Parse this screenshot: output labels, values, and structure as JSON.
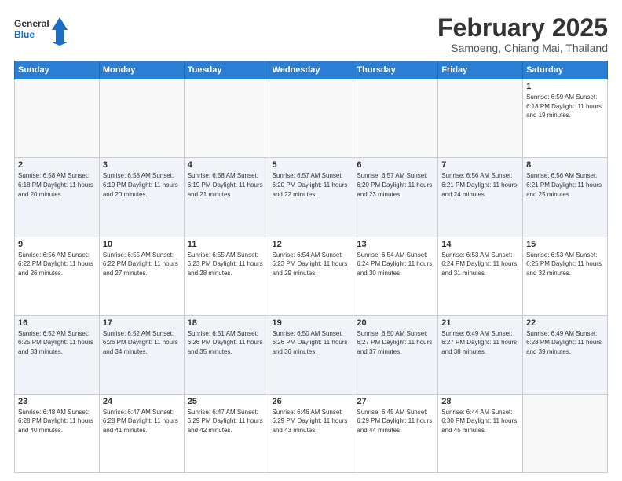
{
  "logo": {
    "text_general": "General",
    "text_blue": "Blue"
  },
  "header": {
    "title": "February 2025",
    "subtitle": "Samoeng, Chiang Mai, Thailand"
  },
  "weekdays": [
    "Sunday",
    "Monday",
    "Tuesday",
    "Wednesday",
    "Thursday",
    "Friday",
    "Saturday"
  ],
  "weeks": [
    [
      {
        "day": "",
        "info": ""
      },
      {
        "day": "",
        "info": ""
      },
      {
        "day": "",
        "info": ""
      },
      {
        "day": "",
        "info": ""
      },
      {
        "day": "",
        "info": ""
      },
      {
        "day": "",
        "info": ""
      },
      {
        "day": "1",
        "info": "Sunrise: 6:59 AM\nSunset: 6:18 PM\nDaylight: 11 hours and 19 minutes."
      }
    ],
    [
      {
        "day": "2",
        "info": "Sunrise: 6:58 AM\nSunset: 6:18 PM\nDaylight: 11 hours and 20 minutes."
      },
      {
        "day": "3",
        "info": "Sunrise: 6:58 AM\nSunset: 6:19 PM\nDaylight: 11 hours and 20 minutes."
      },
      {
        "day": "4",
        "info": "Sunrise: 6:58 AM\nSunset: 6:19 PM\nDaylight: 11 hours and 21 minutes."
      },
      {
        "day": "5",
        "info": "Sunrise: 6:57 AM\nSunset: 6:20 PM\nDaylight: 11 hours and 22 minutes."
      },
      {
        "day": "6",
        "info": "Sunrise: 6:57 AM\nSunset: 6:20 PM\nDaylight: 11 hours and 23 minutes."
      },
      {
        "day": "7",
        "info": "Sunrise: 6:56 AM\nSunset: 6:21 PM\nDaylight: 11 hours and 24 minutes."
      },
      {
        "day": "8",
        "info": "Sunrise: 6:56 AM\nSunset: 6:21 PM\nDaylight: 11 hours and 25 minutes."
      }
    ],
    [
      {
        "day": "9",
        "info": "Sunrise: 6:56 AM\nSunset: 6:22 PM\nDaylight: 11 hours and 26 minutes."
      },
      {
        "day": "10",
        "info": "Sunrise: 6:55 AM\nSunset: 6:22 PM\nDaylight: 11 hours and 27 minutes."
      },
      {
        "day": "11",
        "info": "Sunrise: 6:55 AM\nSunset: 6:23 PM\nDaylight: 11 hours and 28 minutes."
      },
      {
        "day": "12",
        "info": "Sunrise: 6:54 AM\nSunset: 6:23 PM\nDaylight: 11 hours and 29 minutes."
      },
      {
        "day": "13",
        "info": "Sunrise: 6:54 AM\nSunset: 6:24 PM\nDaylight: 11 hours and 30 minutes."
      },
      {
        "day": "14",
        "info": "Sunrise: 6:53 AM\nSunset: 6:24 PM\nDaylight: 11 hours and 31 minutes."
      },
      {
        "day": "15",
        "info": "Sunrise: 6:53 AM\nSunset: 6:25 PM\nDaylight: 11 hours and 32 minutes."
      }
    ],
    [
      {
        "day": "16",
        "info": "Sunrise: 6:52 AM\nSunset: 6:25 PM\nDaylight: 11 hours and 33 minutes."
      },
      {
        "day": "17",
        "info": "Sunrise: 6:52 AM\nSunset: 6:26 PM\nDaylight: 11 hours and 34 minutes."
      },
      {
        "day": "18",
        "info": "Sunrise: 6:51 AM\nSunset: 6:26 PM\nDaylight: 11 hours and 35 minutes."
      },
      {
        "day": "19",
        "info": "Sunrise: 6:50 AM\nSunset: 6:26 PM\nDaylight: 11 hours and 36 minutes."
      },
      {
        "day": "20",
        "info": "Sunrise: 6:50 AM\nSunset: 6:27 PM\nDaylight: 11 hours and 37 minutes."
      },
      {
        "day": "21",
        "info": "Sunrise: 6:49 AM\nSunset: 6:27 PM\nDaylight: 11 hours and 38 minutes."
      },
      {
        "day": "22",
        "info": "Sunrise: 6:49 AM\nSunset: 6:28 PM\nDaylight: 11 hours and 39 minutes."
      }
    ],
    [
      {
        "day": "23",
        "info": "Sunrise: 6:48 AM\nSunset: 6:28 PM\nDaylight: 11 hours and 40 minutes."
      },
      {
        "day": "24",
        "info": "Sunrise: 6:47 AM\nSunset: 6:28 PM\nDaylight: 11 hours and 41 minutes."
      },
      {
        "day": "25",
        "info": "Sunrise: 6:47 AM\nSunset: 6:29 PM\nDaylight: 11 hours and 42 minutes."
      },
      {
        "day": "26",
        "info": "Sunrise: 6:46 AM\nSunset: 6:29 PM\nDaylight: 11 hours and 43 minutes."
      },
      {
        "day": "27",
        "info": "Sunrise: 6:45 AM\nSunset: 6:29 PM\nDaylight: 11 hours and 44 minutes."
      },
      {
        "day": "28",
        "info": "Sunrise: 6:44 AM\nSunset: 6:30 PM\nDaylight: 11 hours and 45 minutes."
      },
      {
        "day": "",
        "info": ""
      }
    ]
  ]
}
